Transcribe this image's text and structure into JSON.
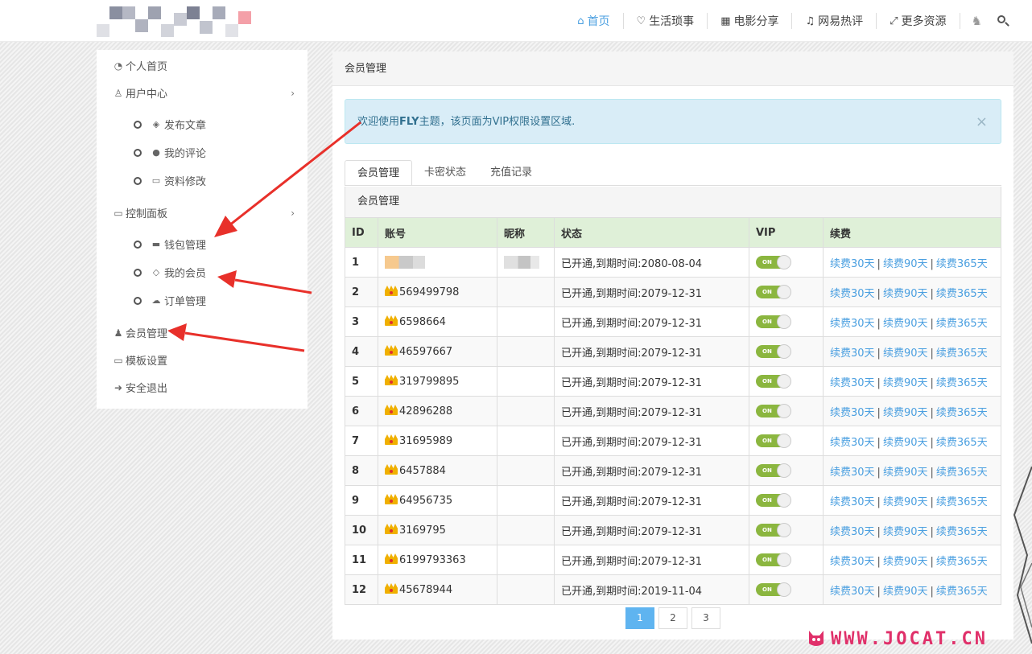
{
  "header": {
    "nav": [
      {
        "label": "首页",
        "icon": "home-icon",
        "glyph": "⌂",
        "active": true
      },
      {
        "label": "生活琐事",
        "icon": "heart-icon",
        "glyph": "♡",
        "active": false
      },
      {
        "label": "电影分享",
        "icon": "film-icon",
        "glyph": "▦",
        "active": false
      },
      {
        "label": "网易热评",
        "icon": "music-icon",
        "glyph": "♫",
        "active": false
      },
      {
        "label": "更多资源",
        "icon": "expand-icon",
        "glyph": "⤢",
        "active": false
      }
    ],
    "accent_color": "#4a9fe0"
  },
  "sidebar": {
    "items": [
      {
        "label": "个人首页",
        "icon": "dashboard-icon",
        "glyph": "◔"
      },
      {
        "label": "用户中心",
        "icon": "user-icon",
        "glyph": "♙",
        "expandable": true
      },
      {
        "label": "发布文章",
        "icon": "cube-icon",
        "glyph": "◈",
        "sub": true
      },
      {
        "label": "我的评论",
        "icon": "comments-icon",
        "glyph": "●",
        "sub": true
      },
      {
        "label": "资料修改",
        "icon": "id-card-icon",
        "glyph": "▭",
        "sub": true
      },
      {
        "label": "控制面板",
        "icon": "desktop-icon",
        "glyph": "▭",
        "expandable": true
      },
      {
        "label": "钱包管理",
        "icon": "credit-card-icon",
        "glyph": "▬",
        "sub": true
      },
      {
        "label": "我的会员",
        "icon": "diamond-icon",
        "glyph": "◇",
        "sub": true
      },
      {
        "label": "订单管理",
        "icon": "cloud-icon",
        "glyph": "☁",
        "sub": true
      },
      {
        "label": "会员管理",
        "icon": "user-solid-icon",
        "glyph": "♟"
      },
      {
        "label": "模板设置",
        "icon": "monitor-icon",
        "glyph": "▭"
      },
      {
        "label": "安全退出",
        "icon": "sign-out-icon",
        "glyph": "➜"
      }
    ]
  },
  "panel": {
    "title": "会员管理",
    "alert": {
      "prefix": "欢迎使用",
      "bold": "FLY",
      "suffix": "主题，该页面为VIP权限设置区域.",
      "close": "×"
    },
    "tabs": [
      "会员管理",
      "卡密状态",
      "充值记录"
    ],
    "sub_title": "会员管理",
    "columns": [
      "ID",
      "账号",
      "昵称",
      "状态",
      "VIP",
      "续费"
    ],
    "toggle_label": "ON",
    "renew_links": [
      "续费30天",
      "续费90天",
      "续费365天"
    ],
    "renew_sep": "|",
    "rows": [
      {
        "id": "1",
        "account": "",
        "nickname": "",
        "status": "已开通,到期时间:2080-08-04",
        "vip": true,
        "blurred": true
      },
      {
        "id": "2",
        "account": "569499798",
        "nickname": "",
        "status": "已开通,到期时间:2079-12-31",
        "vip": true
      },
      {
        "id": "3",
        "account": "6598664",
        "nickname": "",
        "status": "已开通,到期时间:2079-12-31",
        "vip": true
      },
      {
        "id": "4",
        "account": "46597667",
        "nickname": "",
        "status": "已开通,到期时间:2079-12-31",
        "vip": true
      },
      {
        "id": "5",
        "account": "319799895",
        "nickname": "",
        "status": "已开通,到期时间:2079-12-31",
        "vip": true
      },
      {
        "id": "6",
        "account": "42896288",
        "nickname": "",
        "status": "已开通,到期时间:2079-12-31",
        "vip": true
      },
      {
        "id": "7",
        "account": "31695989",
        "nickname": "",
        "status": "已开通,到期时间:2079-12-31",
        "vip": true
      },
      {
        "id": "8",
        "account": "6457884",
        "nickname": "",
        "status": "已开通,到期时间:2079-12-31",
        "vip": true
      },
      {
        "id": "9",
        "account": "64956735",
        "nickname": "",
        "status": "已开通,到期时间:2079-12-31",
        "vip": true
      },
      {
        "id": "10",
        "account": "3169795",
        "nickname": "",
        "status": "已开通,到期时间:2079-12-31",
        "vip": true
      },
      {
        "id": "11",
        "account": "6199793363",
        "nickname": "",
        "status": "已开通,到期时间:2079-12-31",
        "vip": true
      },
      {
        "id": "12",
        "account": "45678944",
        "nickname": "",
        "status": "已开通,到期时间:2019-11-04",
        "vip": true
      }
    ],
    "pages": [
      "1",
      "2",
      "3"
    ],
    "current_page": "1"
  },
  "watermark": "WWW.JOCAT.CN"
}
